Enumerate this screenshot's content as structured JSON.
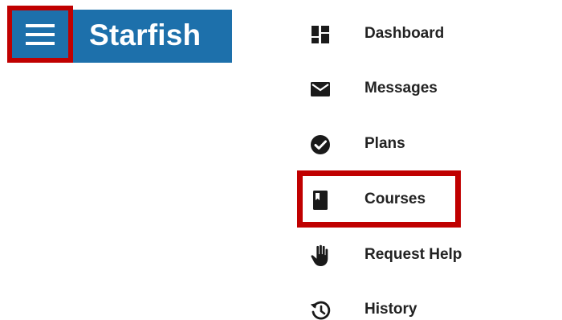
{
  "header": {
    "title": "Starfish",
    "menu_icon": "hamburger-menu-icon",
    "bar_color": "#1d70ab",
    "highlight_color": "#c00000"
  },
  "menu": {
    "items": [
      {
        "label": "Dashboard",
        "icon": "dashboard-icon"
      },
      {
        "label": "Messages",
        "icon": "envelope-icon"
      },
      {
        "label": "Plans",
        "icon": "check-circle-icon"
      },
      {
        "label": "Courses",
        "icon": "book-icon",
        "highlighted": true
      },
      {
        "label": "Request Help",
        "icon": "hand-icon"
      },
      {
        "label": "History",
        "icon": "history-icon"
      }
    ]
  }
}
